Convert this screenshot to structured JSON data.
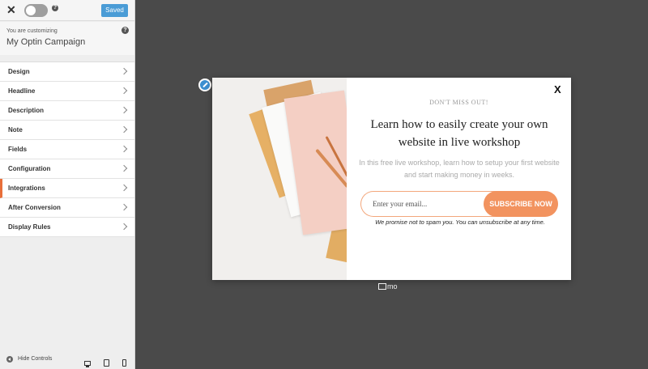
{
  "topbar": {
    "saved_label": "Saved",
    "help_glyph": "?"
  },
  "customizing": {
    "label": "You are customizing",
    "title": "My Optin Campaign"
  },
  "menu": {
    "items": [
      {
        "label": "Design"
      },
      {
        "label": "Headline"
      },
      {
        "label": "Description"
      },
      {
        "label": "Note"
      },
      {
        "label": "Fields"
      },
      {
        "label": "Configuration"
      },
      {
        "label": "Integrations"
      },
      {
        "label": "After Conversion"
      },
      {
        "label": "Display Rules"
      }
    ],
    "active": "Integrations"
  },
  "bottom": {
    "hide_controls": "Hide Controls"
  },
  "popup": {
    "close_glyph": "X",
    "eyebrow": "DON'T MISS OUT!",
    "headline": "Learn how to easily create your own website in live workshop",
    "description": "In this free live workshop, learn how to setup your first website and start making money in weeks.",
    "email_placeholder": "Enter your email...",
    "subscribe_label": "SUBSCRIBE NOW",
    "note": "We promise not to spam you. You can unsubscribe at any time."
  },
  "branding": {
    "logo_text": "mo"
  },
  "colors": {
    "accent": "#f2935f",
    "saved_button": "#4a9cd6",
    "active_indicator": "#e86f3a",
    "canvas": "#4a4a4a"
  }
}
